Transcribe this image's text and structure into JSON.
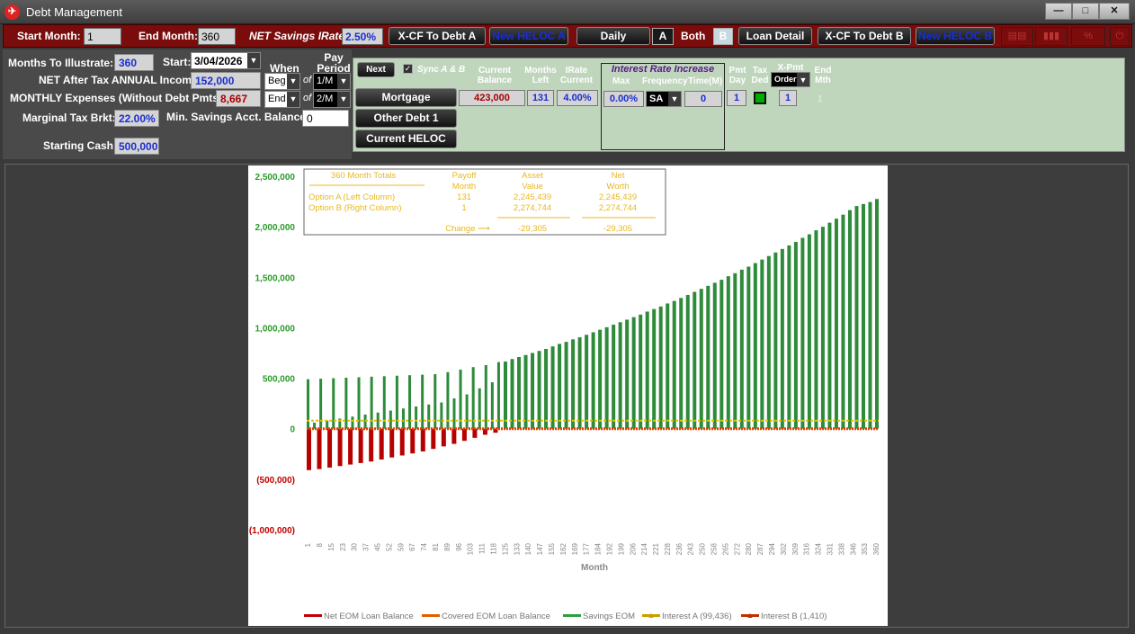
{
  "window": {
    "title": "Debt Management",
    "app_icon": "app-logo-icon",
    "buttons": [
      "—",
      "□",
      "✕"
    ]
  },
  "toolbar": {
    "start_month_label": "Start Month:",
    "start_month": "1",
    "end_month_label": "End Month:",
    "end_month": "360",
    "savings_rate_label": "NET Savings IRate:",
    "savings_rate": "2.50%",
    "xcf_a": "X-CF To Debt A",
    "new_heloc_a": "New HELOC A",
    "daily": "Daily",
    "opt_a": "A",
    "both": "Both",
    "opt_b": "B",
    "loan_detail": "Loan Detail",
    "xcf_b": "X-CF To Debt B",
    "new_heloc_b": "New HELOC B"
  },
  "left": {
    "months_label": "Months To Illustrate:",
    "months": "360",
    "start_label": "Start:",
    "start_date": "3/04/2026",
    "when_label": "When",
    "pay_period_label": "Pay Period",
    "income_label": "NET After Tax ANNUAL Income:",
    "income": "152,000",
    "income_when": "Beg",
    "of1": "of",
    "income_period": "1/M",
    "expenses_label": "MONTHLY Expenses (Without Debt Pmts):",
    "expenses": "8,667",
    "expenses_when": "End",
    "of2": "of",
    "expenses_period": "2/M",
    "tax_label": "Marginal Tax Brkt:",
    "tax": "22.00%",
    "min_savings_label": "Min. Savings Acct. Balance:",
    "min_savings": "0",
    "cash_label": "Starting Cash:",
    "cash": "500,000"
  },
  "debts": {
    "next": "Next",
    "sync_label": "Sync A & B",
    "headers": {
      "balance": "Current Balance",
      "months_left": "Months Left",
      "irate": "IRate Current",
      "irate_increase": "Interest Rate Increase",
      "max": "Max",
      "freq": "Frequency",
      "time": "Time(M)",
      "pmt_day": "Pmt Day",
      "tax_ded": "Tax Ded",
      "xpmt": "X-Pmt",
      "end_mth": "End Mth"
    },
    "buttons": [
      "Mortgage",
      "Other Debt 1",
      "Current HELOC"
    ],
    "row": {
      "balance": "423,000",
      "months_left": "131",
      "irate": "4.00%",
      "max": "0.00%",
      "freq": "SA",
      "time": "0",
      "pmt_day": "1",
      "xpmt_order": "Order",
      "xpmt": "1",
      "end_mth": "1"
    }
  },
  "chart_data": {
    "type": "bar",
    "ylim": [
      -1000000,
      2500000
    ],
    "yticks": [
      {
        "v": 2500000,
        "label": "2,500,000"
      },
      {
        "v": 2000000,
        "label": "2,000,000"
      },
      {
        "v": 1500000,
        "label": "1,500,000"
      },
      {
        "v": 1000000,
        "label": "1,000,000"
      },
      {
        "v": 500000,
        "label": "500,000"
      },
      {
        "v": 0,
        "label": "0"
      },
      {
        "v": -500000,
        "label": "(500,000)"
      },
      {
        "v": -1000000,
        "label": "(1,000,000)"
      }
    ],
    "xlabel": "Month",
    "xticks": [
      "1",
      "8",
      "15",
      "23",
      "30",
      "37",
      "45",
      "52",
      "59",
      "67",
      "74",
      "81",
      "89",
      "96",
      "103",
      "111",
      "118",
      "125",
      "133",
      "140",
      "147",
      "155",
      "162",
      "169",
      "177",
      "184",
      "192",
      "199",
      "206",
      "214",
      "221",
      "228",
      "236",
      "243",
      "250",
      "258",
      "265",
      "272",
      "280",
      "287",
      "294",
      "302",
      "309",
      "316",
      "324",
      "331",
      "338",
      "346",
      "353",
      "360"
    ],
    "series": [
      {
        "name": "Savings EOM (Option A)",
        "values": [
          490000,
          60000,
          495000,
          80000,
          500000,
          100000,
          505000,
          120000,
          510000,
          140000,
          515000,
          160000,
          520000,
          180000,
          525000,
          200000,
          530000,
          220000,
          535000,
          240000,
          540000,
          260000,
          560000,
          300000,
          585000,
          340000,
          610000,
          400000,
          630000,
          460000,
          660000
        ]
      },
      {
        "name": "Net EOM Loan Balance (Option A)",
        "values": [
          -410000,
          -400000,
          -385000,
          -370000,
          -355000,
          -340000,
          -325000,
          -305000,
          -285000,
          -265000,
          -245000,
          -225000,
          -200000,
          -175000,
          -150000,
          -120000,
          -90000,
          -60000,
          -40000
        ]
      },
      {
        "name": "Savings EOM (Option B)",
        "values": [
          665000,
          690000,
          710000,
          730000,
          750000,
          770000,
          790000,
          815000,
          840000,
          860000,
          885000,
          905000,
          930000,
          955000,
          980000,
          1005000,
          1030000,
          1055000,
          1080000,
          1105000,
          1130000,
          1160000,
          1185000,
          1210000,
          1240000,
          1265000,
          1295000,
          1325000,
          1355000,
          1385000,
          1415000,
          1445000,
          1475000,
          1510000,
          1540000,
          1575000,
          1605000,
          1640000,
          1675000,
          1710000,
          1745000,
          1780000,
          1815000,
          1850000,
          1890000,
          1925000,
          1965000,
          2000000,
          2040000,
          2080000,
          2120000,
          2165000,
          2205000,
          2225000,
          2245000,
          2275000
        ]
      }
    ],
    "interest_level": 80000,
    "totals": {
      "title": "360 Month Totals",
      "col_payoff": "Payoff",
      "col_payoff2": "Month",
      "col_asset": "Asset",
      "col_asset2": "Value",
      "col_net": "Net",
      "col_net2": "Worth",
      "row_a": "Option A (Left  Column)",
      "a_payoff": "131",
      "a_asset": "2,245,439",
      "a_net": "2,245,439",
      "row_b": "Option B (Right Column)",
      "b_payoff": "1",
      "b_asset": "2,274,744",
      "b_net": "2,274,744",
      "change_label": "Change ⟶",
      "change_asset": "-29,305",
      "change_net": "-29,305"
    },
    "legend": [
      {
        "label": "Net EOM Loan Balance",
        "color": "#c00000"
      },
      {
        "label": "Covered EOM Loan Balance",
        "color": "#e06000"
      },
      {
        "label": "Savings EOM",
        "color": "#2e9e3e"
      },
      {
        "label": "Interest A (99,436)",
        "color": "#c8a000"
      },
      {
        "label": "Interest B (1,410)",
        "color": "#c03000"
      }
    ],
    "colors": {
      "axis_pos": "#2a9a2a",
      "axis_neg": "#c00000",
      "savings": "#2e8b3a",
      "loan": "#b80000",
      "interest": "#e0c000"
    }
  }
}
